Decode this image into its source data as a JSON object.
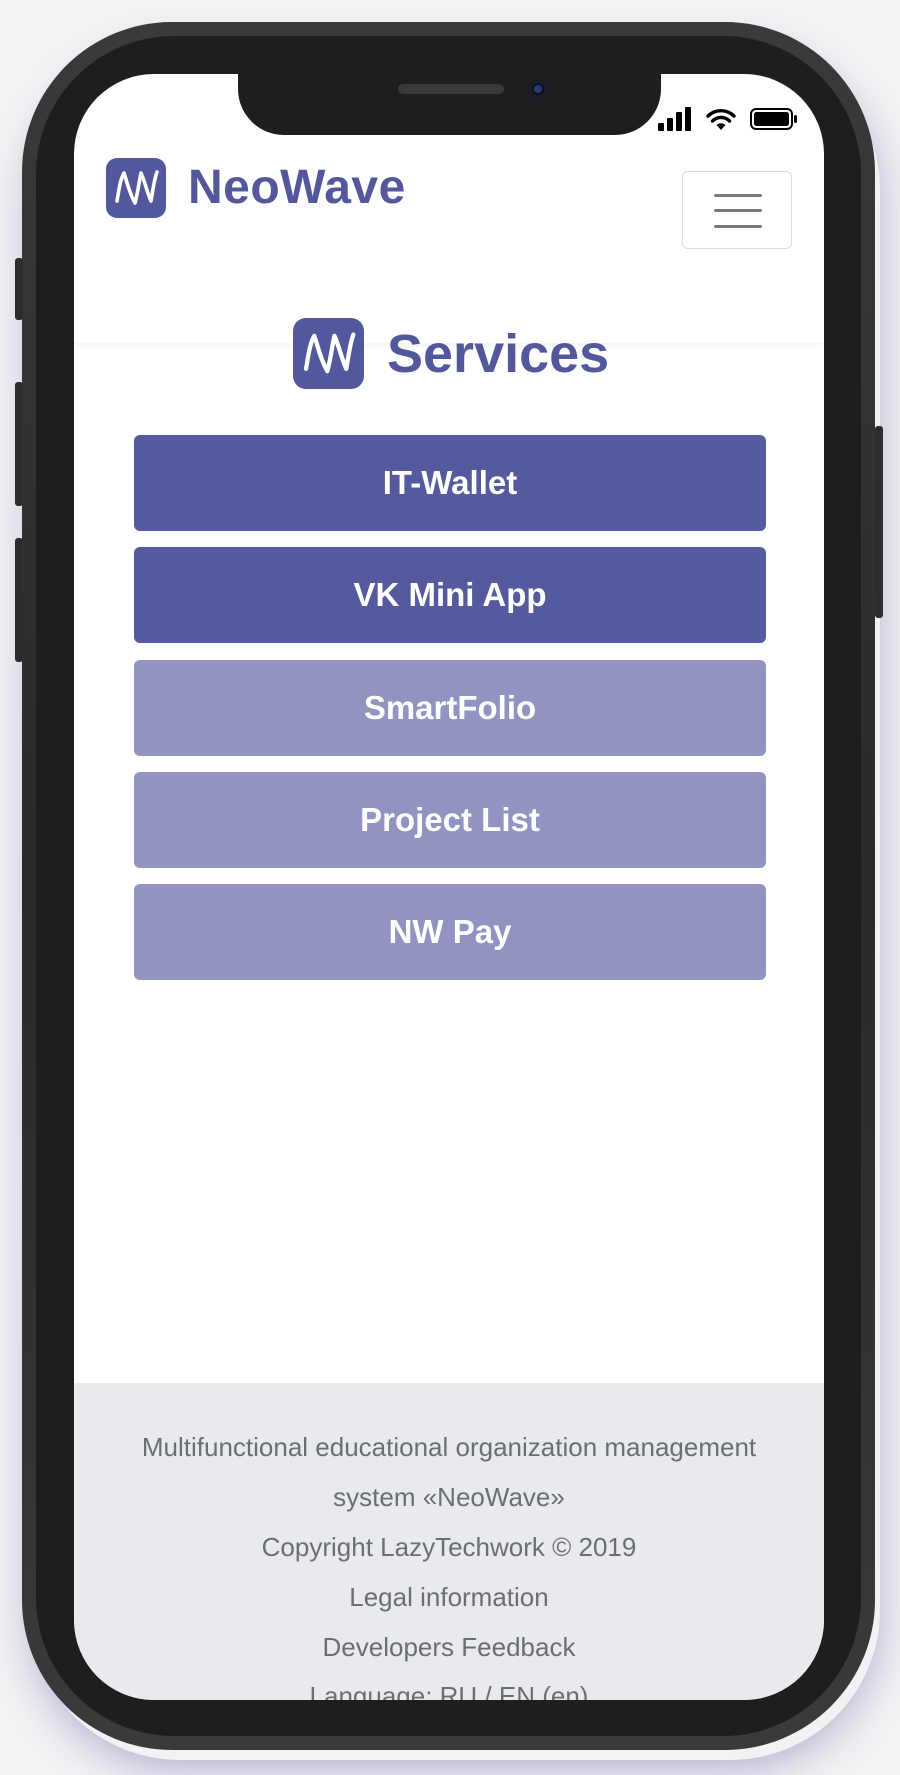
{
  "status_bar": {
    "signal_icon": "cellular-signal-icon",
    "wifi_icon": "wifi-icon",
    "battery_icon": "battery-full-icon"
  },
  "navbar": {
    "brand_logo_icon": "neowave-logo-icon",
    "brand_name": "NeoWave",
    "menu_icon": "hamburger-menu-icon"
  },
  "main": {
    "heading_logo_icon": "neowave-logo-icon",
    "heading": "Services",
    "services": [
      {
        "label": "IT-Wallet",
        "state": "active"
      },
      {
        "label": "VK Mini App",
        "state": "active"
      },
      {
        "label": "SmartFolio",
        "state": "muted"
      },
      {
        "label": "Project List",
        "state": "muted"
      },
      {
        "label": "NW Pay",
        "state": "muted"
      }
    ]
  },
  "footer": {
    "description_line1": "Multifunctional educational organization management",
    "description_line2": "system «NeoWave»",
    "copyright": "Copyright LazyTechwork © 2019",
    "legal_link": "Legal information",
    "feedback_link": "Developers Feedback",
    "language_switch": "Language: RU / EN (en)"
  },
  "colors": {
    "brand": "#53579c",
    "button_active": "#545a9d",
    "button_muted": "#9194c0",
    "footer_bg": "#e8eaee",
    "footer_text": "#6b6e73"
  }
}
